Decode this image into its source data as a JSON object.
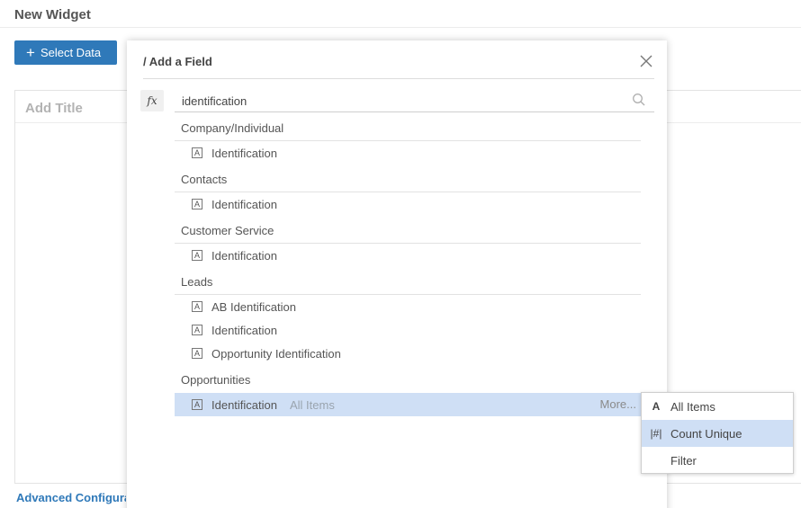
{
  "page": {
    "title": "New Widget",
    "select_data_label": "Select Data",
    "canvas_title": "Add Title",
    "advanced_link": "Advanced Configuration"
  },
  "modal": {
    "title": "/ Add a Field",
    "fx_label": "fx",
    "search_value": "identification",
    "more_label": "More...",
    "groups": [
      {
        "name": "Company/Individual",
        "fields": [
          {
            "label": "Identification",
            "type_icon": "A"
          }
        ]
      },
      {
        "name": "Contacts",
        "fields": [
          {
            "label": "Identification",
            "type_icon": "A"
          }
        ]
      },
      {
        "name": "Customer Service",
        "fields": [
          {
            "label": "Identification",
            "type_icon": "A"
          }
        ]
      },
      {
        "name": "Leads",
        "fields": [
          {
            "label": "AB Identification",
            "type_icon": "A"
          },
          {
            "label": "Identification",
            "type_icon": "A"
          },
          {
            "label": "Opportunity Identification",
            "type_icon": "A"
          }
        ]
      },
      {
        "name": "Opportunities",
        "fields": [
          {
            "label": "Identification",
            "type_icon": "A",
            "aggregation": "All Items",
            "selected": true
          }
        ]
      }
    ]
  },
  "aggregation_menu": {
    "items": [
      {
        "icon": "A",
        "label": "All Items"
      },
      {
        "icon": "|#|",
        "label": "Count Unique",
        "active": true
      },
      {
        "icon": "",
        "label": "Filter"
      }
    ]
  },
  "colors": {
    "accent": "#2f79b9",
    "selection": "#cfdff5"
  }
}
